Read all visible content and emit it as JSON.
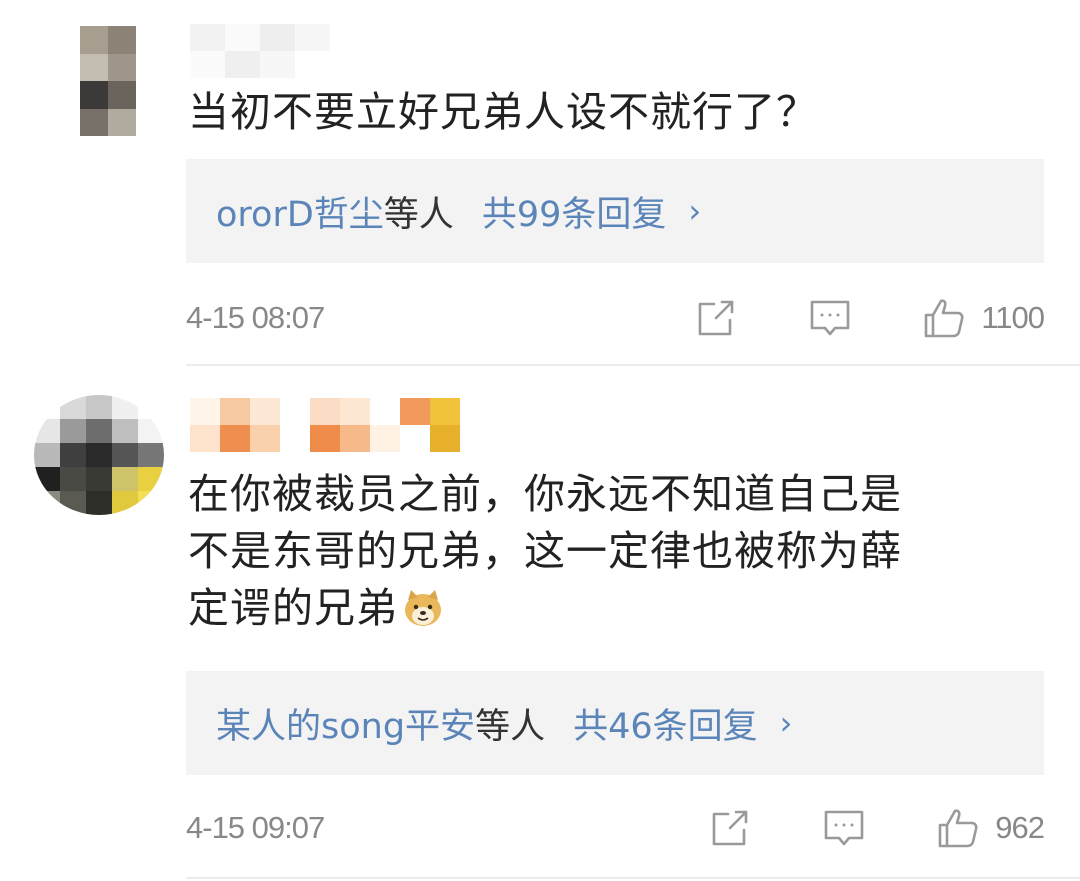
{
  "comments": [
    {
      "text": "当初不要立好兄弟人设不就行了？",
      "replies": {
        "users": "ororD哲尘",
        "suffix": "等人",
        "total": "共99条回复",
        "chevron": "›"
      },
      "timestamp": "4-15 08:07",
      "likes": "1100"
    },
    {
      "text": "在你被裁员之前，你永远不知道自己是\n不是东哥的兄弟，这一定律也被称为薛\n定谔的兄弟",
      "emoji": "doge-emoji",
      "replies": {
        "users": "某人的song平安",
        "suffix": "等人",
        "total": "共46条回复",
        "chevron": "›"
      },
      "timestamp": "4-15 09:07",
      "likes": "962"
    }
  ],
  "icons": {
    "share": "share-icon",
    "comment": "comment-icon",
    "like": "thumbs-up-icon"
  },
  "colors": {
    "link": "#5b85b8",
    "text": "#222222",
    "meta": "#888888",
    "reply_bg": "#f3f3f3"
  }
}
